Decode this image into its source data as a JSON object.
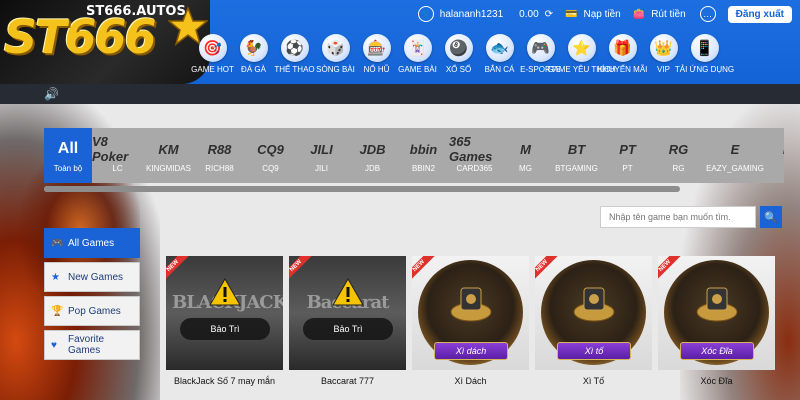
{
  "brand": {
    "name": "ST666",
    "domain": "ST666.AUTOS"
  },
  "user": {
    "username": "halananh1231",
    "balance": "0.00",
    "deposit": "Nạp tiền",
    "withdraw": "Rút tiền",
    "logout": "Đăng xuất"
  },
  "nav": [
    {
      "label": "GAME HOT",
      "icon": "hot-icon",
      "glyph": "🎯"
    },
    {
      "label": "ĐÁ GÀ",
      "icon": "rooster-icon",
      "glyph": "🐓"
    },
    {
      "label": "THỂ THAO",
      "icon": "soccer-icon",
      "glyph": "⚽"
    },
    {
      "label": "SÒNG BÀI",
      "icon": "casino-icon",
      "glyph": "🎲"
    },
    {
      "label": "NỔ HŨ",
      "icon": "jackpot-icon",
      "glyph": "🎰"
    },
    {
      "label": "GAME BÀI",
      "icon": "cards-icon",
      "glyph": "🃏"
    },
    {
      "label": "XỔ SỐ",
      "icon": "lottery-icon",
      "glyph": "🎱"
    },
    {
      "label": "BẮN CÁ",
      "icon": "fish-icon",
      "glyph": "🐟"
    },
    {
      "label": "E-SPORTS",
      "icon": "gamepad-icon",
      "glyph": "🎮"
    },
    {
      "label": "GAME YÊU THÍCH",
      "icon": "star-icon",
      "glyph": "⭐"
    },
    {
      "label": "KHUYẾN MÃI",
      "icon": "promo-icon",
      "glyph": "🎁"
    },
    {
      "label": "VIP",
      "icon": "vip-icon",
      "glyph": "👑"
    },
    {
      "label": "TẢI ỨNG DỤNG",
      "icon": "app-icon",
      "glyph": "📱"
    }
  ],
  "providers": [
    {
      "logo": "All",
      "name": "Toàn bộ",
      "active": true
    },
    {
      "logo": "V8 Poker",
      "name": "LC"
    },
    {
      "logo": "KM",
      "name": "KINGMIDAS"
    },
    {
      "logo": "R88",
      "name": "RICH88"
    },
    {
      "logo": "CQ9",
      "name": "CQ9"
    },
    {
      "logo": "JILI",
      "name": "JILI"
    },
    {
      "logo": "JDB",
      "name": "JDB"
    },
    {
      "logo": "bbin",
      "name": "BBIN2"
    },
    {
      "logo": "365 Games",
      "name": "CARD365"
    },
    {
      "logo": "M",
      "name": "MG"
    },
    {
      "logo": "BT",
      "name": "BTGAMING"
    },
    {
      "logo": "PT",
      "name": "PT"
    },
    {
      "logo": "RG",
      "name": "RG"
    },
    {
      "logo": "E",
      "name": "EAZY_GAMING"
    },
    {
      "logo": "EV",
      "name": "EV"
    }
  ],
  "search": {
    "placeholder": "Nhập tên game bạn muốn tìm."
  },
  "categories": [
    {
      "label": "All Games",
      "icon": "gamepad-icon",
      "active": true
    },
    {
      "label": "New Games",
      "icon": "star-icon"
    },
    {
      "label": "Pop Games",
      "icon": "trophy-icon"
    },
    {
      "label": "Favorite Games",
      "icon": "heart-icon"
    }
  ],
  "games": [
    {
      "name": "BlackJack Số 7 may mắn",
      "art": "BLACKJACK",
      "status": "Bảo Trì",
      "badge": "NEW"
    },
    {
      "name": "Baccarat 777",
      "art": "Baccarat",
      "status": "Bảo Trì",
      "badge": "NEW"
    },
    {
      "name": "Xì Dách",
      "ribbon": "Xì dách",
      "badge": "NEW"
    },
    {
      "name": "Xì Tố",
      "ribbon": "Xì tố",
      "badge": "NEW"
    },
    {
      "name": "Xóc Đĩa",
      "ribbon": "Xóc Đĩa",
      "badge": "NEW"
    }
  ],
  "colors": {
    "primary": "#1463d6",
    "dark_bar": "#272c34",
    "gold": "#f4c21b",
    "badge": "#e0302b"
  }
}
